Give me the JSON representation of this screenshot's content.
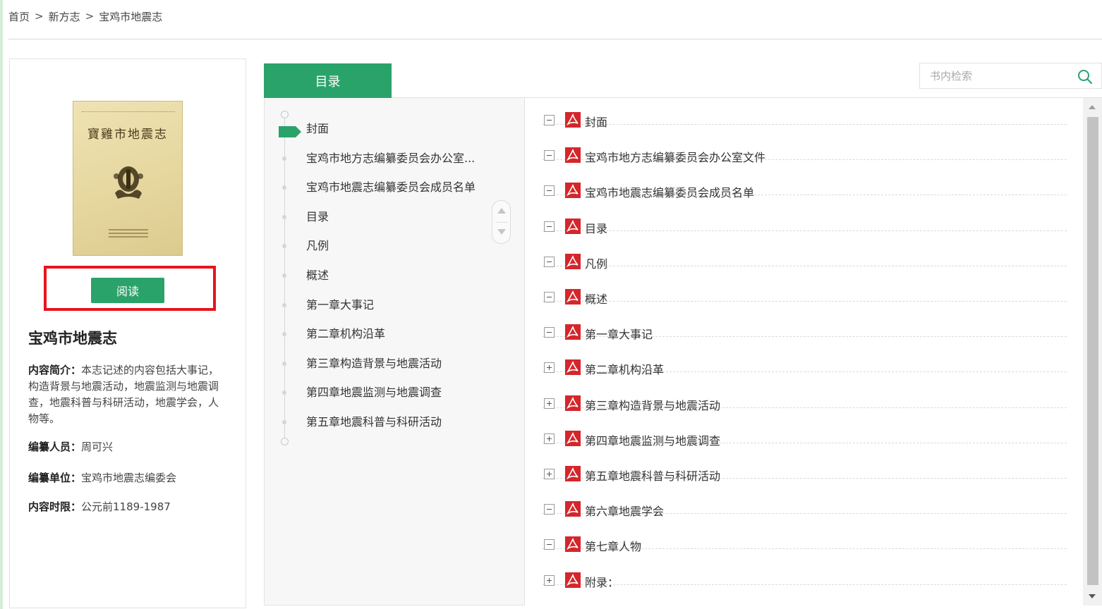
{
  "breadcrumb": {
    "items": [
      "首页",
      "新方志",
      "宝鸡市地震志"
    ],
    "separator": ">"
  },
  "book": {
    "cover_title": "寶雞市地震志",
    "read_button": "阅读",
    "title": "宝鸡市地震志",
    "summary_label": "内容简介：",
    "summary": "本志记述的内容包括大事记，构造背景与地震活动，地震监测与地震调查，地震科普与科研活动，地震学会，人物等。",
    "editor_label": "编纂人员：",
    "editor": "周可兴",
    "unit_label": "编纂单位：",
    "unit": "宝鸡市地震志编委会",
    "period_label": "内容时限：",
    "period": "公元前1189-1987"
  },
  "tab": {
    "label": "目录"
  },
  "search": {
    "placeholder": "书内检索",
    "value": ""
  },
  "toc": {
    "active_index": 0,
    "items": [
      "封面",
      "宝鸡市地方志编纂委员会办公室...",
      "宝鸡市地震志编纂委员会成员名单",
      "目录",
      "凡例",
      "概述",
      "第一章大事记",
      "第二章机构沿革",
      "第三章构造背景与地震活动",
      "第四章地震监测与地震调查",
      "第五章地震科普与科研活动"
    ]
  },
  "tree": {
    "items": [
      {
        "label": "封面",
        "toggle": "minus"
      },
      {
        "label": "宝鸡市地方志编纂委员会办公室文件",
        "toggle": "minus"
      },
      {
        "label": "宝鸡市地震志编纂委员会成员名单",
        "toggle": "minus"
      },
      {
        "label": "目录",
        "toggle": "minus"
      },
      {
        "label": "凡例",
        "toggle": "minus"
      },
      {
        "label": "概述",
        "toggle": "minus"
      },
      {
        "label": "第一章大事记",
        "toggle": "minus"
      },
      {
        "label": "第二章机构沿革",
        "toggle": "plus"
      },
      {
        "label": "第三章构造背景与地震活动",
        "toggle": "plus"
      },
      {
        "label": "第四章地震监测与地震调查",
        "toggle": "plus"
      },
      {
        "label": "第五章地震科普与科研活动",
        "toggle": "plus"
      },
      {
        "label": "第六章地震学会",
        "toggle": "minus"
      },
      {
        "label": "第七章人物",
        "toggle": "minus"
      },
      {
        "label": "附录：",
        "toggle": "plus"
      }
    ]
  },
  "colors": {
    "accent": "#2aa36b",
    "highlight": "#e8141b",
    "pdf_icon": "#d4262b"
  },
  "icons": {
    "search": "search-icon",
    "pdf": "pdf-icon",
    "toggle_minus": "minus-box-icon",
    "toggle_plus": "plus-box-icon"
  }
}
